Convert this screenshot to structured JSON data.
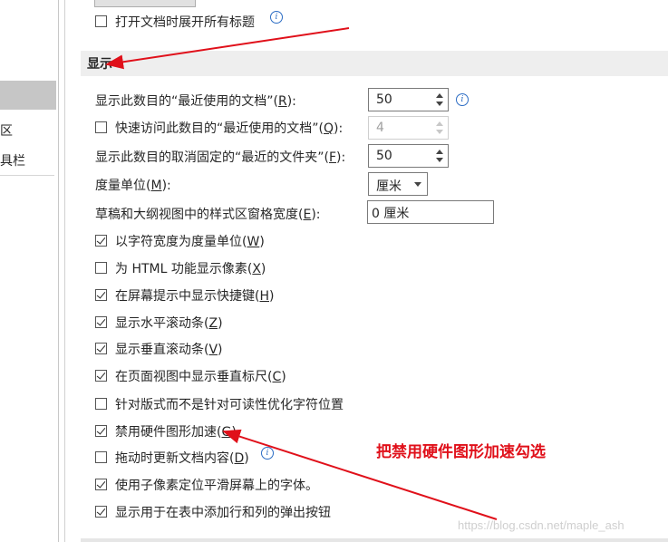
{
  "left_panel": {
    "items": [
      {
        "label": "区"
      },
      {
        "label": "具栏"
      }
    ]
  },
  "top": {
    "expand_headings_label": "打开文档时展开所有标题",
    "expand_headings_checked": false
  },
  "section": {
    "title": "显示"
  },
  "fields": {
    "recent_docs": {
      "label_pre": "显示此数目的“最近使用的文档”(",
      "key": "R",
      "label_post": "):",
      "value": "50"
    },
    "quick_access": {
      "label_pre": "快速访问此数目的“最近使用的文档”(",
      "key": "Q",
      "label_post": "):",
      "value": "4",
      "checked": false
    },
    "unpinned_folders": {
      "label_pre": "显示此数目的取消固定的“最近的文件夹”(",
      "key": "F",
      "label_post": "):",
      "value": "50"
    },
    "units": {
      "label_pre": "度量单位(",
      "key": "M",
      "label_post": "):",
      "value": "厘米"
    },
    "style_area": {
      "label_pre": "草稿和大纲视图中的样式区窗格宽度(",
      "key": "E",
      "label_post": "):",
      "value": "0 厘米"
    }
  },
  "checkboxes": [
    {
      "label_pre": "以字符宽度为度量单位(",
      "key": "W",
      "label_post": ")",
      "checked": true
    },
    {
      "label_pre": "为 HTML 功能显示像素(",
      "key": "X",
      "label_post": ")",
      "checked": false
    },
    {
      "label_pre": "在屏幕提示中显示快捷键(",
      "key": "H",
      "label_post": ")",
      "checked": true
    },
    {
      "label_pre": "显示水平滚动条(",
      "key": "Z",
      "label_post": ")",
      "checked": true
    },
    {
      "label_pre": "显示垂直滚动条(",
      "key": "V",
      "label_post": ")",
      "checked": true
    },
    {
      "label_pre": "在页面视图中显示垂直标尺(",
      "key": "C",
      "label_post": ")",
      "checked": true
    },
    {
      "label_pre": "针对版式而不是针对可读性优化字符位置",
      "key": "",
      "label_post": "",
      "checked": false
    },
    {
      "label_pre": "禁用硬件图形加速(",
      "key": "G",
      "label_post": ")",
      "checked": true
    },
    {
      "label_pre": "拖动时更新文档内容(",
      "key": "D",
      "label_post": ")",
      "checked": false
    },
    {
      "label_pre": "使用子像素定位平滑屏幕上的字体。",
      "key": "",
      "label_post": "",
      "checked": true
    },
    {
      "label_pre": "显示用于在表中添加行和列的弹出按钮",
      "key": "",
      "label_post": "",
      "checked": true
    }
  ],
  "annotation": {
    "text": "把禁用硬件图形加速勾选",
    "color": "#e0101a"
  },
  "watermark": "https://blog.csdn.net/maple_ash",
  "colors": {
    "section_bg": "#eeeeee",
    "info_icon": "#2b6cc4"
  }
}
